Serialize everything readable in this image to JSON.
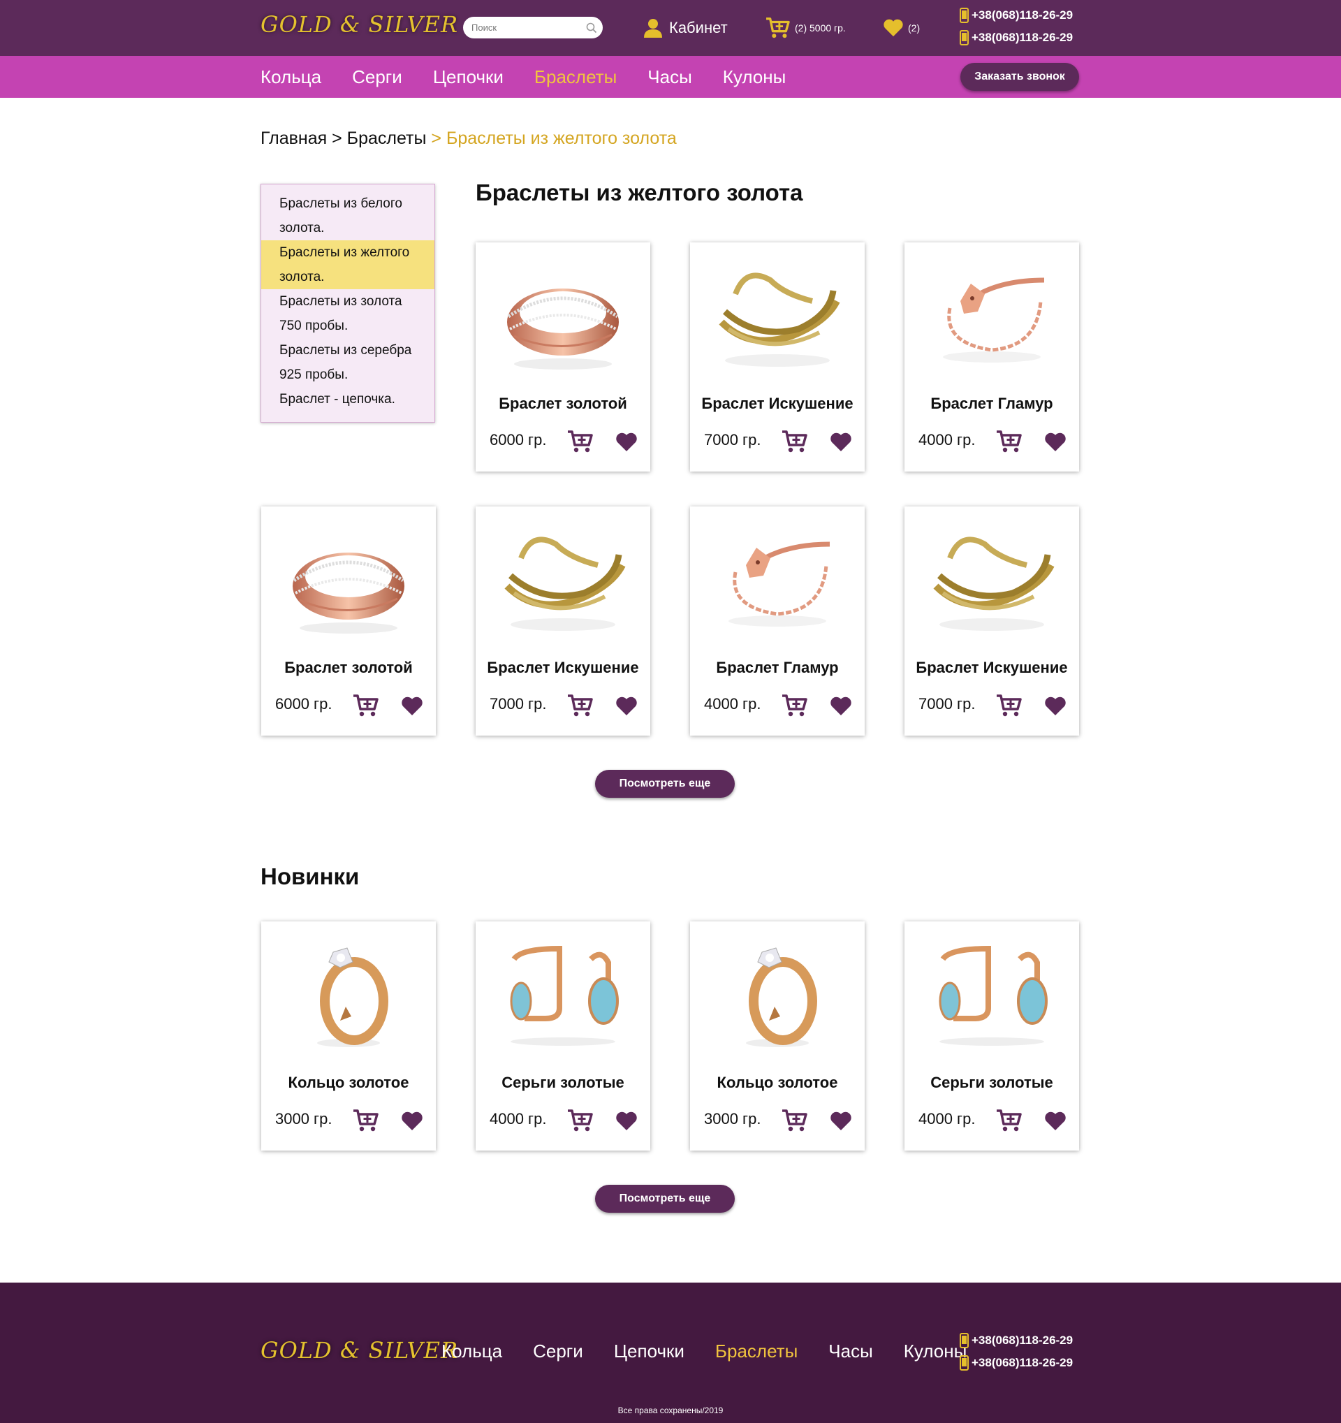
{
  "header": {
    "logo": "GOLD & SILVER",
    "search_placeholder": "Поиск",
    "cabinet": "Кабинет",
    "cart_summary": "(2) 5000 гр.",
    "favorites_count": "(2)",
    "phones": [
      "+38(068)118-26-29",
      "+38(068)118-26-29"
    ]
  },
  "nav": {
    "items": [
      "Кольца",
      "Серги",
      "Цепочки",
      "Браслеты",
      "Часы",
      "Кулоны"
    ],
    "active": "Браслеты",
    "callback_button": "Заказать звонок"
  },
  "breadcrumb": {
    "home": "Главная",
    "sep1": " > ",
    "category": "Браслеты",
    "current": " > Браслеты из желтого золота"
  },
  "sidebar": {
    "items": [
      "Браслеты из белого золота.",
      "Браслеты из желтого золота.",
      "Браслеты из золота 750 пробы.",
      "Браслеты из серебра 925 пробы.",
      "Браслет - цепочка."
    ],
    "active_index": 1
  },
  "catalog": {
    "title": "Браслеты из желтого золота",
    "products": [
      {
        "name": "Браслет золотой",
        "price": "6000 гр.",
        "image": "rose-gold-ring"
      },
      {
        "name": "Браслет Искушение",
        "price": "7000 гр.",
        "image": "gold-cuff"
      },
      {
        "name": "Браслет Гламур",
        "price": "4000 гр.",
        "image": "fox-bracelet"
      },
      {
        "name": "Браслет золотой",
        "price": "6000 гр.",
        "image": "rose-gold-ring"
      },
      {
        "name": "Браслет Искушение",
        "price": "7000 гр.",
        "image": "gold-cuff"
      },
      {
        "name": "Браслет Гламур",
        "price": "4000 гр.",
        "image": "fox-bracelet"
      },
      {
        "name": "Браслет Искушение",
        "price": "7000 гр.",
        "image": "gold-cuff"
      }
    ],
    "more_button": "Посмотреть еще"
  },
  "new_items": {
    "title": "Новинки",
    "products": [
      {
        "name": "Кольцо золотое",
        "price": "3000 гр.",
        "image": "diamond-ring"
      },
      {
        "name": "Серьги золотые",
        "price": "4000 гр.",
        "image": "topaz-earrings"
      },
      {
        "name": "Кольцо золотое",
        "price": "3000 гр.",
        "image": "diamond-ring"
      },
      {
        "name": "Серьги золотые",
        "price": "4000 гр.",
        "image": "topaz-earrings"
      }
    ],
    "more_button": "Посмотреть еще"
  },
  "footer": {
    "logo": "GOLD & SILVER",
    "nav": [
      "Кольца",
      "Серги",
      "Цепочки",
      "Браслеты",
      "Часы",
      "Кулоны"
    ],
    "active": "Браслеты",
    "phones": [
      "+38(068)118-26-29",
      "+38(068)118-26-29"
    ],
    "copyright": "Все права сохранены/2019"
  },
  "colors": {
    "header_bg": "#5c2a5a",
    "nav_bg": "#c443b2",
    "accent_gold": "#f1c43e",
    "footer_bg": "#441940",
    "sidebar_bg": "#f6eaf6",
    "sidebar_active": "#f6e17e"
  }
}
